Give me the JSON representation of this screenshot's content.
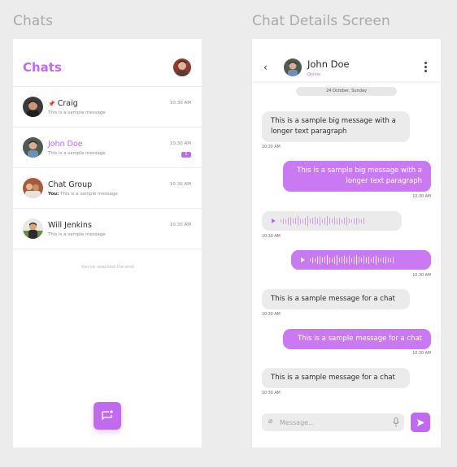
{
  "labels": {
    "left_screen": "Chats",
    "right_screen": "Chat Details Screen"
  },
  "chats_screen": {
    "title": "Chats",
    "items": [
      {
        "name": "Craig",
        "pinned": true,
        "message_prefix": "",
        "message": "This is a sample message",
        "time": "10:30 AM"
      },
      {
        "name": "John Doe",
        "active": true,
        "message_prefix": "",
        "message": "This is a sample message",
        "time": "10:30 AM",
        "unread": "1"
      },
      {
        "name": "Chat Group",
        "message_prefix": "You:",
        "message": "This is a sample message",
        "time": "10:30 AM"
      },
      {
        "name": "Will Jenkins",
        "message_prefix": "",
        "message": "This is a sample message",
        "time": "10:30 AM"
      }
    ],
    "end_text": "You've reached the end"
  },
  "detail_screen": {
    "contact": {
      "name": "John Doe",
      "status": "Online"
    },
    "date_divider": "24 October, Sunday",
    "messages": [
      {
        "direction": "in",
        "type": "text",
        "text": "This is a sample big message with a longer text paragraph",
        "time": "10:30 AM"
      },
      {
        "direction": "out",
        "type": "text",
        "text": "This is a sample big message with a longer text paragraph",
        "time": "10:30 AM"
      },
      {
        "direction": "in",
        "type": "voice",
        "time": "10:30 AM"
      },
      {
        "direction": "out",
        "type": "voice",
        "time": "10:30 AM"
      },
      {
        "direction": "in",
        "type": "text",
        "text": "This is a sample message for a chat",
        "time": "10:30 AM"
      },
      {
        "direction": "out",
        "type": "text",
        "text": "This is a sample message for a chat",
        "time": "10:30 AM"
      },
      {
        "direction": "in",
        "type": "text",
        "text": "This is a sample message for a chat",
        "time": "10:30 AM"
      }
    ],
    "composer": {
      "placeholder": "Message..."
    }
  },
  "colors": {
    "accent": "#c06af0",
    "out_bubble": "#c97af2",
    "in_bubble": "#ebebeb"
  }
}
